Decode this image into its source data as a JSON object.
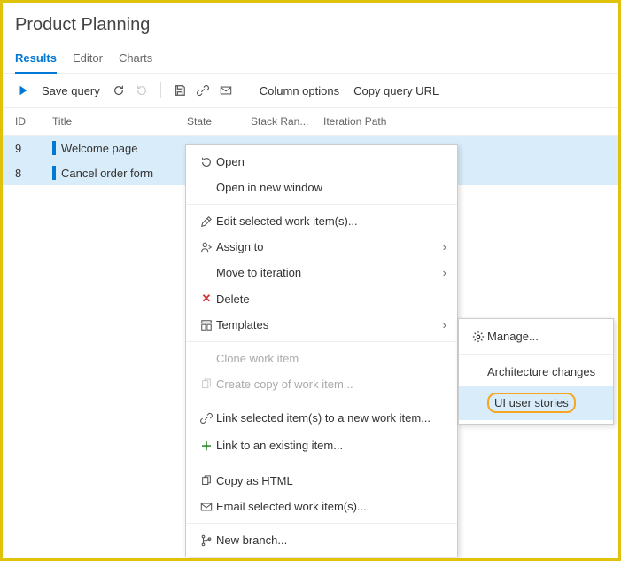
{
  "title": "Product Planning",
  "tabs": {
    "results": "Results",
    "editor": "Editor",
    "charts": "Charts"
  },
  "toolbar": {
    "save": "Save query",
    "columns": "Column options",
    "copy_url": "Copy query URL"
  },
  "columns": {
    "id": "ID",
    "title": "Title",
    "state": "State",
    "rank": "Stack Ran...",
    "iter": "Iteration Path"
  },
  "rows": [
    {
      "id": "9",
      "title": "Welcome page"
    },
    {
      "id": "8",
      "title": "Cancel order form"
    }
  ],
  "menu": {
    "open": "Open",
    "open_new": "Open in new window",
    "edit": "Edit selected work item(s)...",
    "assign": "Assign to",
    "move": "Move to iteration",
    "delete": "Delete",
    "templates": "Templates",
    "clone": "Clone work item",
    "copy_of": "Create copy of work item...",
    "link_new": "Link selected item(s) to a new work item...",
    "link_existing": "Link to an existing item...",
    "copy_html": "Copy as HTML",
    "email": "Email selected work item(s)...",
    "branch": "New branch..."
  },
  "submenu": {
    "manage": "Manage...",
    "arch": "Architecture changes",
    "ui": "UI user stories"
  }
}
